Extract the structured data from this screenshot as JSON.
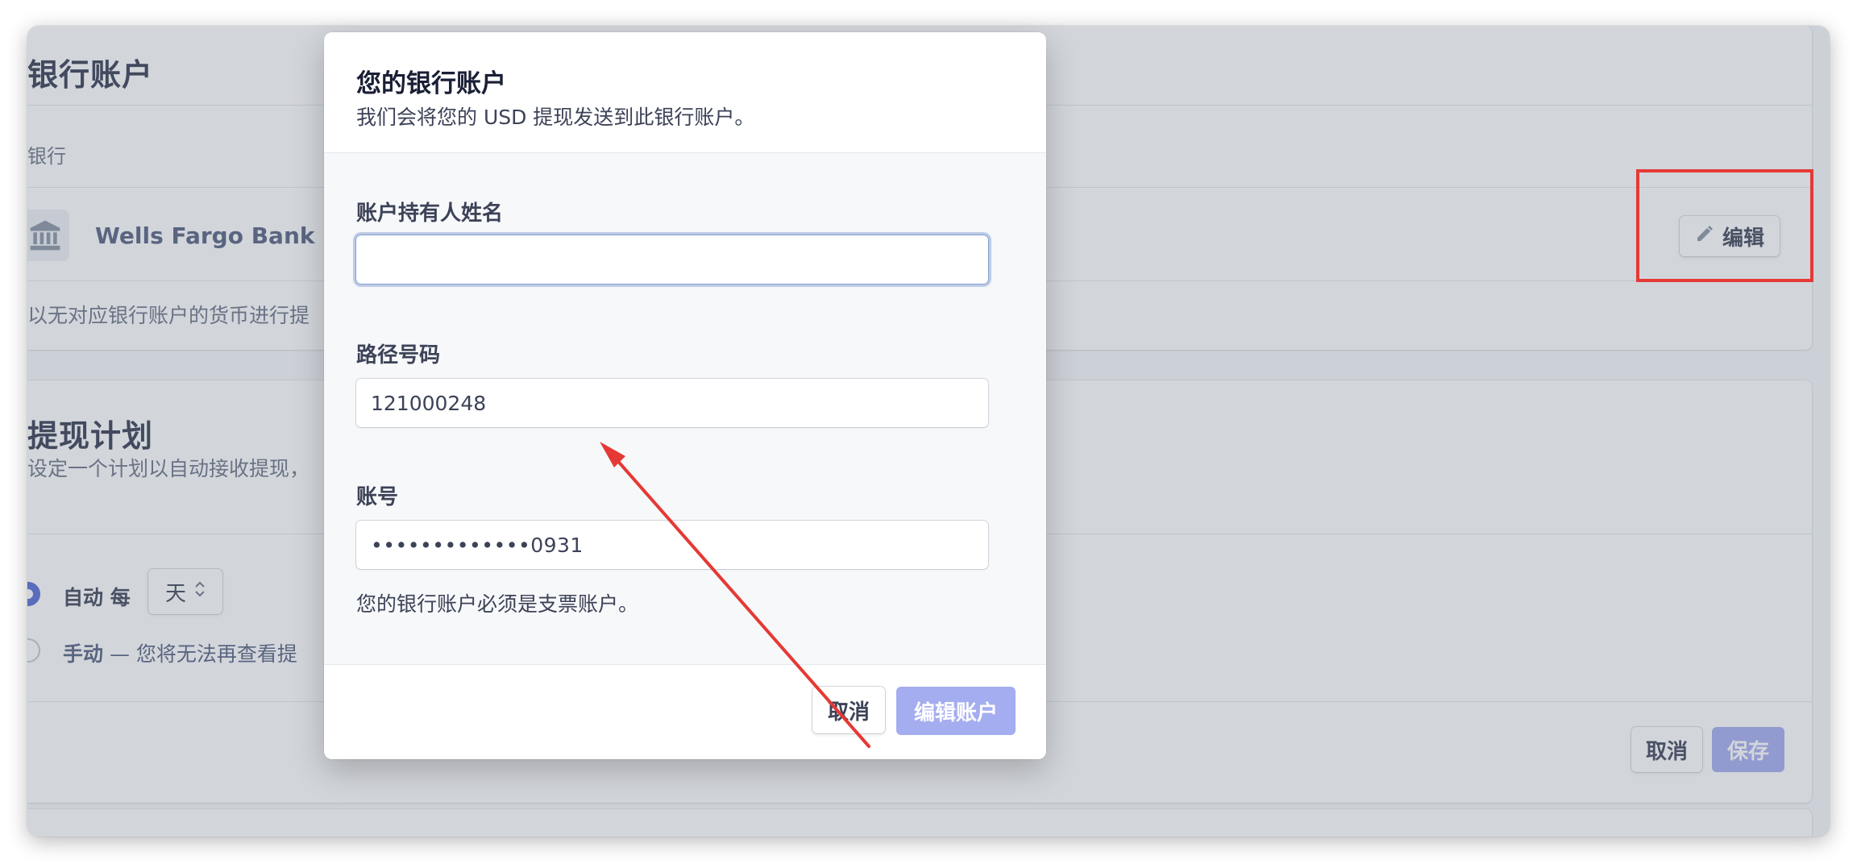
{
  "bank_section": {
    "title": "银行账户",
    "header_label": "银行",
    "bank_name": "Wells Fargo Bank",
    "edit_label": "编辑",
    "note": "以无对应银行账户的货币进行提"
  },
  "payout_section": {
    "title": "提现计划",
    "description": "设定一个计划以自动接收提现，",
    "auto_label": "自动 每",
    "interval_value": "天",
    "manual_prefix": "手动",
    "manual_text": " — 您将无法再查看提",
    "cancel_label": "取消",
    "save_label": "保存"
  },
  "modal": {
    "title": "您的银行账户",
    "subtitle": "我们会将您的 USD 提现发送到此银行账户。",
    "holder_label": "账户持有人姓名",
    "holder_value": "",
    "routing_label": "路径号码",
    "routing_value": "121000248",
    "account_label": "账号",
    "account_value": "•••••••••••••0931",
    "account_note": "您的银行账户必须是支票账户。",
    "cancel_label": "取消",
    "submit_label": "编辑账户"
  },
  "colors": {
    "accent": "#5469d4",
    "primary_disabled": "#a4adef",
    "annotation": "#e53935"
  },
  "icons": {
    "bank": "bank-icon",
    "edit": "pencil-icon",
    "select_arrows": "chevron-up-down-icon"
  }
}
